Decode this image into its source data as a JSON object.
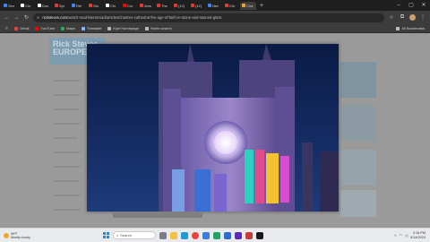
{
  "browser": {
    "tabs": [
      {
        "label": "Sen",
        "color": "#4285f4"
      },
      {
        "label": "Chr",
        "color": "#ffffff"
      },
      {
        "label": "Dos",
        "color": "#ffffff"
      },
      {
        "label": "Spl",
        "color": "#e53935"
      },
      {
        "label": "Rei",
        "color": "#4285f4"
      },
      {
        "label": "Sto",
        "color": "#e53935"
      },
      {
        "label": "Chr",
        "color": "#ffffff"
      },
      {
        "label": "Cor",
        "color": "#ff0000"
      },
      {
        "label": "Ams",
        "color": "#e53935"
      },
      {
        "label": "The",
        "color": "#e53935"
      },
      {
        "label": "(12)",
        "color": "#e53935"
      },
      {
        "label": "(12)",
        "color": "#e53935"
      },
      {
        "label": "Nev",
        "color": "#4285f4"
      },
      {
        "label": "Chr",
        "color": "#e53935"
      },
      {
        "label": "Cha",
        "color": "#f2a72b"
      }
    ],
    "new_tab": "+",
    "url_host": "ricksteves.com",
    "url_path": "/watch-read-listen/read/articles/chartres-cathedral-the-age-of-faith-in-stone-and-stained-glass",
    "bookmarks": [
      "Gmail",
      "YouTube",
      "Maps",
      "Translate",
      "Kyle Homepage",
      "Home search"
    ],
    "all_bookmarks": "All Bookmarks"
  },
  "page": {
    "logo_text": "Rick Steves EUROPE",
    "lightbox_image": "Chartres Cathedral facade illuminated with colorful light projection at night"
  },
  "taskbar": {
    "weather_temp": "59°F",
    "weather_desc": "Mostly cloudy",
    "search_placeholder": "Search",
    "time": "2:16 PM",
    "date": "5/14/2024"
  }
}
